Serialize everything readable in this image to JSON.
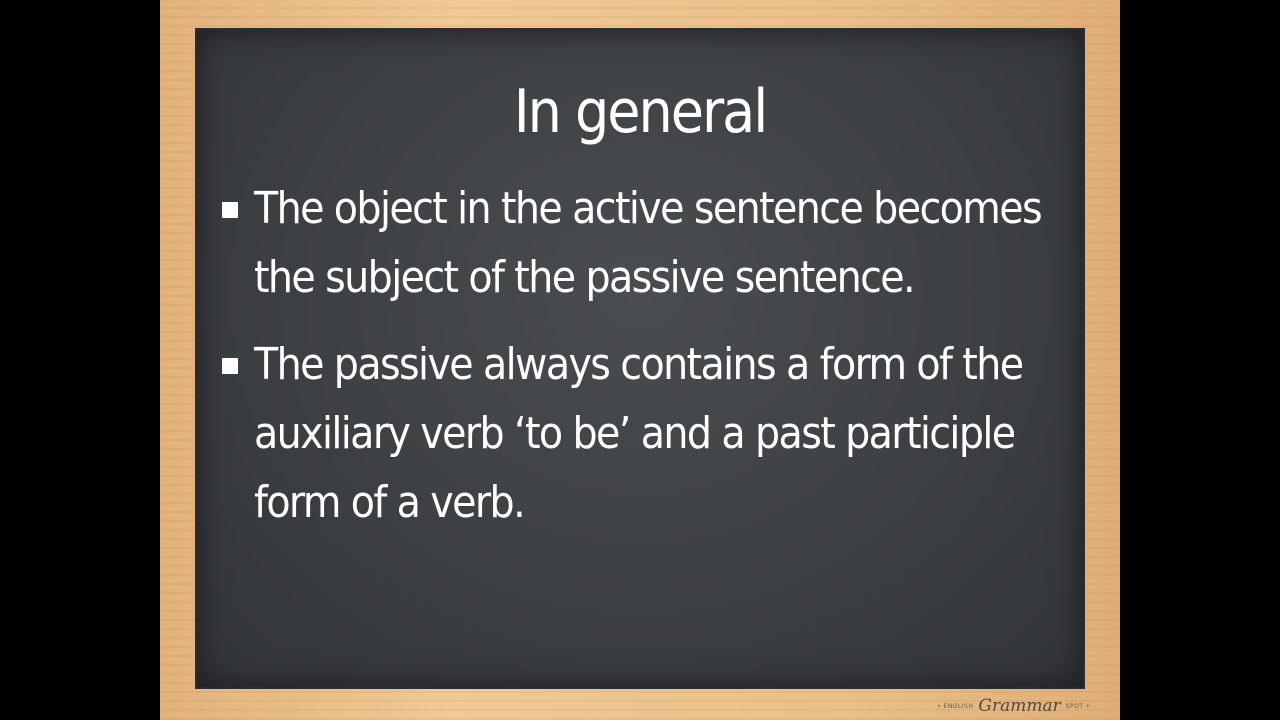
{
  "slide": {
    "title": "In general",
    "bullets": [
      "The object in the active sentence becomes the subject of the passive sentence.",
      "The passive always contains a form of the auxiliary verb ‘to be’ and a past participle form of a verb."
    ]
  },
  "logo": {
    "pre": "• ENGLISH",
    "name": "Grammar",
    "post": "SPOT •"
  },
  "colors": {
    "board": "#3f4245",
    "frame": "#e8bc86",
    "text": "#ffffff",
    "background": "#000000"
  }
}
